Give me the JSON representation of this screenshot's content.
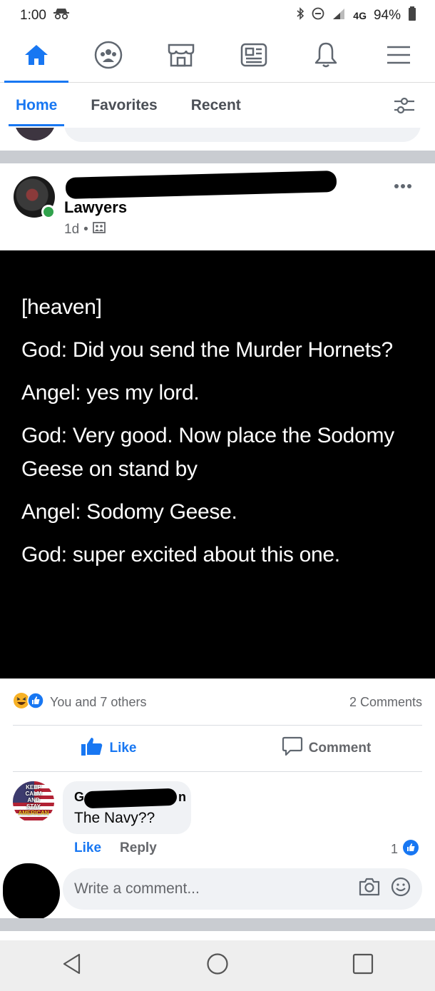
{
  "status_bar": {
    "time": "1:00",
    "network": "4G",
    "battery": "94%"
  },
  "nav": {
    "items": [
      {
        "icon": "home-icon",
        "active": true
      },
      {
        "icon": "groups-icon",
        "active": false
      },
      {
        "icon": "marketplace-icon",
        "active": false
      },
      {
        "icon": "news-icon",
        "active": false
      },
      {
        "icon": "notifications-icon",
        "active": false
      },
      {
        "icon": "menu-icon",
        "active": false
      }
    ]
  },
  "tabs": [
    "Home",
    "Favorites",
    "Recent"
  ],
  "post": {
    "group_name": "Lawyers",
    "time": "1d",
    "image_lines": [
      "[heaven]",
      "God: Did you send the Murder Hornets?",
      "Angel: yes my lord.",
      "God: Very good. Now place the Sodomy Geese on stand by",
      "Angel: Sodomy Geese.",
      "God: super excited about this one."
    ],
    "reactions_text": "You and 7 others",
    "comments_count": "2 Comments",
    "like_label": "Like",
    "comment_label": "Comment"
  },
  "comment": {
    "author_visible": "G",
    "author_visible_end": "n",
    "text": "The Navy??",
    "like_label": "Like",
    "reply_label": "Reply",
    "like_count": "1",
    "avatar_text": [
      "KEEP",
      "CALM",
      "AND",
      "STAY",
      "AMERICAN"
    ]
  },
  "composer": {
    "placeholder": "Write a comment..."
  },
  "colors": {
    "accent": "#1877f2",
    "online": "#31a24c",
    "haha": "#f7b125"
  }
}
